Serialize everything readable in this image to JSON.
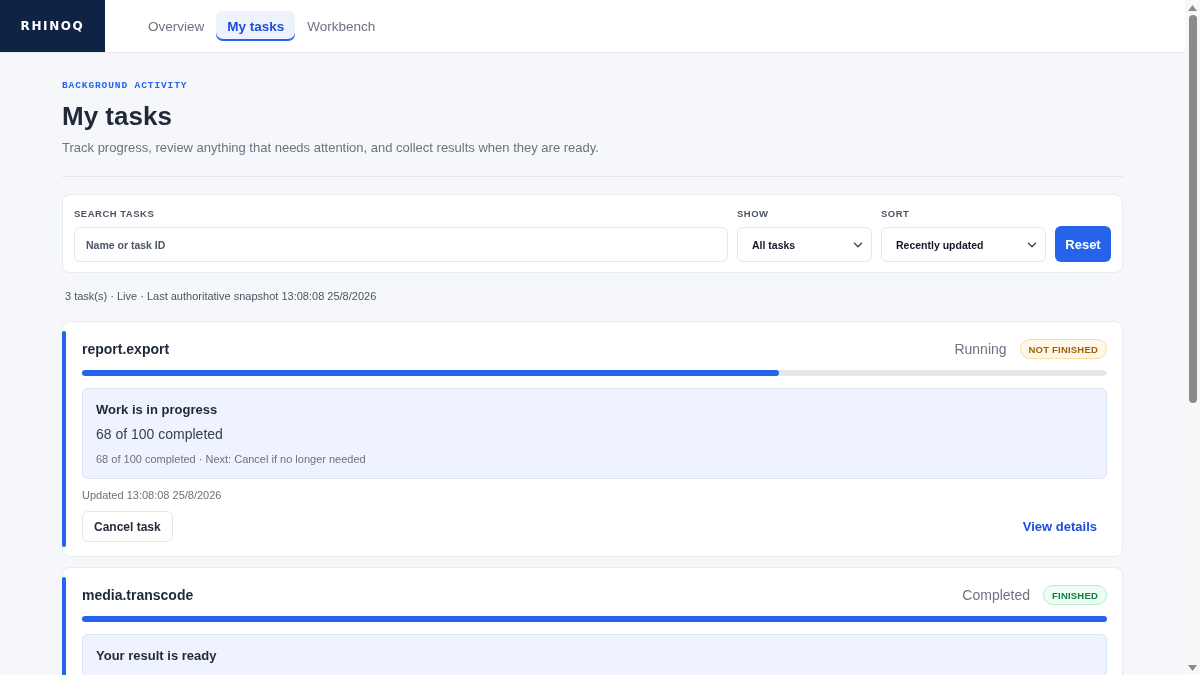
{
  "brand": {
    "logo": "RHINOQ"
  },
  "tabs": [
    {
      "label": "Overview",
      "selected": false
    },
    {
      "label": "My tasks",
      "selected": true
    },
    {
      "label": "Workbench",
      "selected": false
    }
  ],
  "page_header": {
    "eyebrow": "BACKGROUND ACTIVITY",
    "title": "My tasks",
    "subtitle": "Track progress, review anything that needs attention, and collect results when they are ready."
  },
  "filters": {
    "search": {
      "label": "SEARCH TASKS",
      "placeholder": "Name or task ID"
    },
    "show": {
      "label": "SHOW",
      "value": "All tasks"
    },
    "sort": {
      "label": "SORT",
      "value": "Recently updated"
    },
    "reset_button": "Reset"
  },
  "summary": "3 task(s) · Live · Last authoritative snapshot 13:08:08 25/8/2026",
  "tasks": [
    {
      "name": "report.export",
      "status": "Running",
      "badge": {
        "label": "NOT FINISHED",
        "kind": "pending"
      },
      "level": 0.68,
      "notice": {
        "title": "Work is in progress",
        "body": "68 of 100 completed",
        "detail": "68 of 100 completed · Next: Cancel if no longer needed"
      },
      "updated": "Updated 13:08:08 25/8/2026",
      "action": "Cancel task",
      "link": "View details"
    },
    {
      "name": "media.transcode",
      "status": "Completed",
      "badge": {
        "label": "FINISHED",
        "kind": "done"
      },
      "level": 1,
      "notice": {
        "title": "Your result is ready"
      }
    }
  ]
}
